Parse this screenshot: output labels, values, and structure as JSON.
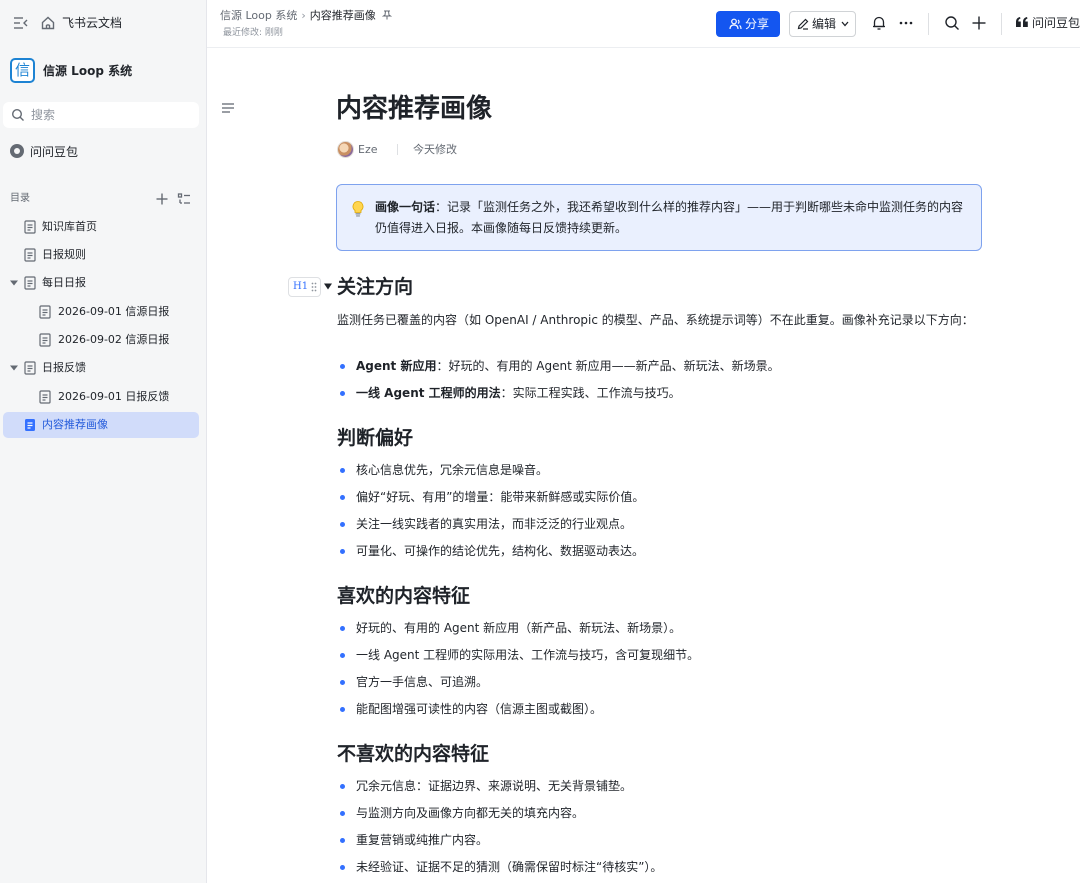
{
  "app": {
    "name": "飞书云文档"
  },
  "space": {
    "logo_char": "信",
    "name": "信源 Loop 系统"
  },
  "search": {
    "placeholder": "搜索"
  },
  "doubao": {
    "label": "问问豆包"
  },
  "toc": {
    "title": "目录"
  },
  "tree": [
    {
      "label": "知识库首页"
    },
    {
      "label": "日报规则"
    },
    {
      "label": "每日日报"
    },
    {
      "label": "2026-09-01 信源日报"
    },
    {
      "label": "2026-09-02 信源日报"
    },
    {
      "label": "日报反馈"
    },
    {
      "label": "2026-09-01 日报反馈"
    },
    {
      "label": "内容推荐画像"
    }
  ],
  "header": {
    "breadcrumb_root": "信源 Loop 系统",
    "breadcrumb_current": "内容推荐画像",
    "last_modified": "最近修改: 刚刚",
    "share_label": "分享",
    "edit_label": "编辑",
    "ask_label": "问问豆包"
  },
  "doc": {
    "title": "内容推荐画像",
    "author": "Eze",
    "modified": "今天修改",
    "callout_label": "画像一句话",
    "callout_text": "：记录「监测任务之外，我还希望收到什么样的推荐内容」——用于判断哪些未命中监测任务的内容仍值得进入日报。本画像随每日反馈持续更新。",
    "h1_badge": "H1",
    "sections": {
      "focus": {
        "title": "关注方向",
        "intro": "监测任务已覆盖的内容（如 OpenAI / Anthropic 的模型、产品、系统提示词等）不在此重复。画像补充记录以下方向：",
        "items": [
          {
            "bold": "Agent 新应用",
            "text": "：好玩的、有用的 Agent 新应用——新产品、新玩法、新场景。"
          },
          {
            "bold": "一线 Agent 工程师的用法",
            "text": "：实际工程实践、工作流与技巧。"
          }
        ]
      },
      "preference": {
        "title": "判断偏好",
        "items": [
          "核心信息优先，冗余元信息是噪音。",
          "偏好“好玩、有用”的增量：能带来新鲜感或实际价值。",
          "关注一线实践者的真实用法，而非泛泛的行业观点。",
          "可量化、可操作的结论优先，结构化、数据驱动表达。"
        ]
      },
      "like": {
        "title": "喜欢的内容特征",
        "items": [
          "好玩的、有用的 Agent 新应用（新产品、新玩法、新场景）。",
          "一线 Agent 工程师的实际用法、工作流与技巧，含可复现细节。",
          "官方一手信息、可追溯。",
          "能配图增强可读性的内容（信源主图或截图）。"
        ]
      },
      "dislike": {
        "title": "不喜欢的内容特征",
        "items": [
          "冗余元信息：证据边界、来源说明、无关背景铺垫。",
          "与监测方向及画像方向都无关的填充内容。",
          "重复营销或纯推广内容。",
          "未经验证、证据不足的猜测（确需保留时标注“待核实”）。"
        ]
      }
    }
  }
}
